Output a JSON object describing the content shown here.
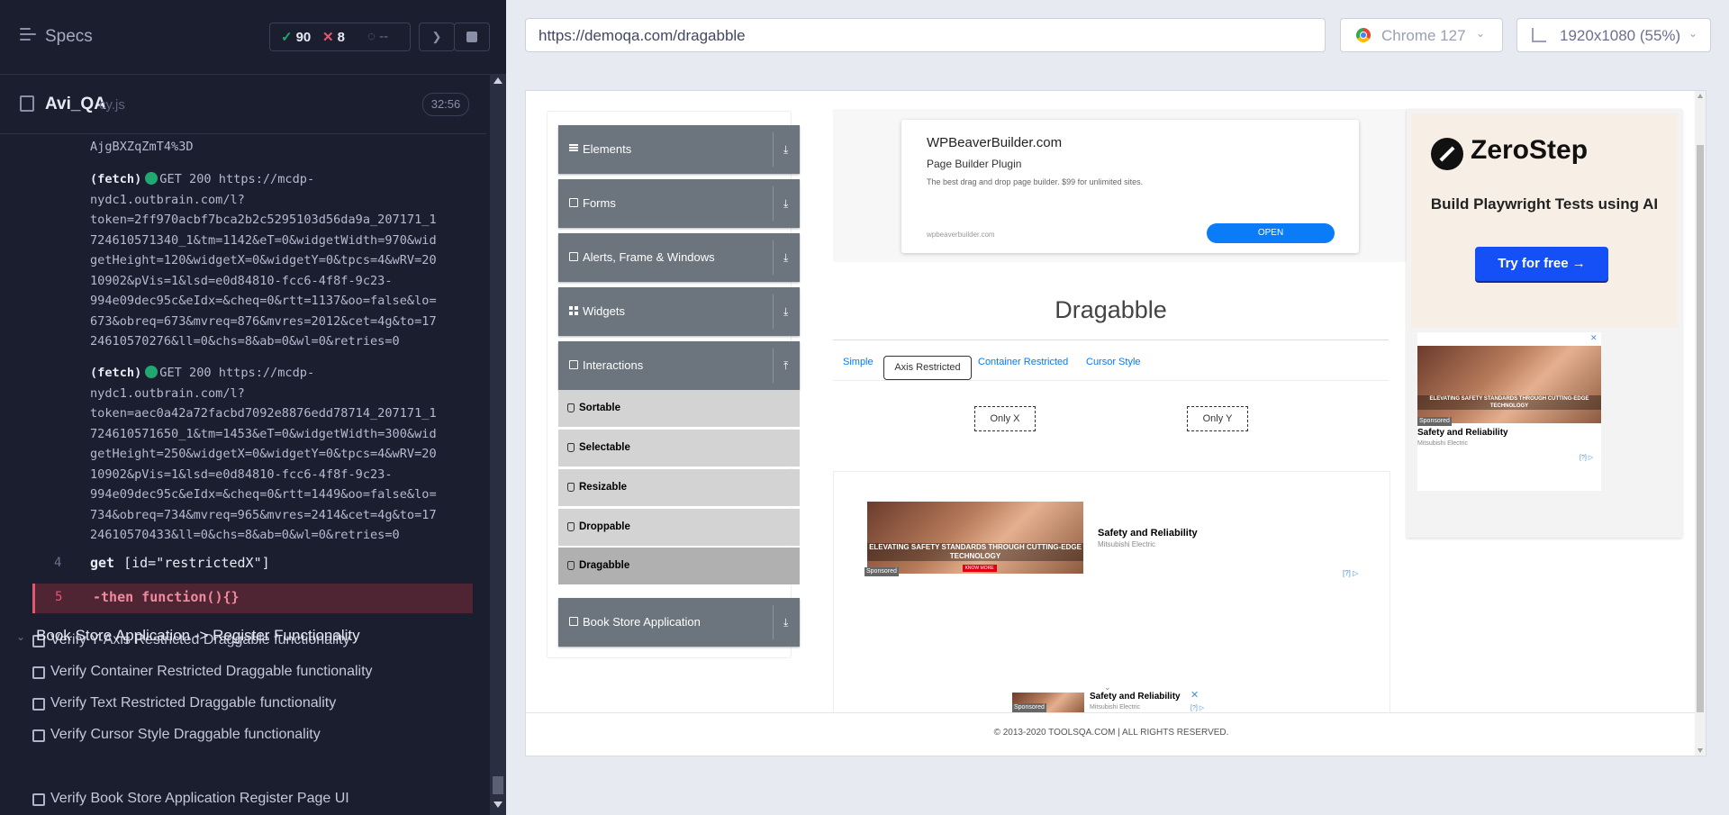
{
  "runner": {
    "specs_title": "Specs",
    "stats": {
      "passed": "90",
      "failed": "8",
      "pending": "--"
    },
    "file": {
      "name": "Avi_QA",
      "ext": "cy.js",
      "time": "32:56"
    },
    "log_top": "AjgBXZqZmT4%3D",
    "log_entry_1": "(fetch)  GET 200 https://mcdp-\nnydc1.outbrain.com/l?\ntoken=2ff970acbf7bca2b2c5295103d56da9a_207171_1\n724610571340_1&tm=1142&eT=0&widgetWidth=970&wid\ngetHeight=120&widgetX=0&widgetY=0&tpcs=4&wRV=20\n10902&pVis=1&lsd=e0d84810-fcc6-4f8f-9c23-\n994e09dec95c&eIdx=&cheq=0&rtt=1137&oo=false&lo=\n673&obreq=673&mvreq=876&mvres=2012&cet=4g&to=17\n24610570276&ll=0&chs=8&ab=0&wl=0&retries=0",
    "log_entry_2": "(fetch)  GET 200 https://mcdp-\nnydc1.outbrain.com/l?\ntoken=aec0a42a72facbd7092e8876edd78714_207171_1\n724610571650_1&tm=1453&eT=0&widgetWidth=300&wid\ngetHeight=250&widgetX=0&widgetY=0&tpcs=4&wRV=20\n10902&pVis=1&lsd=e0d84810-fcc6-4f8f-9c23-\n994e09dec95c&eIdx=&cheq=0&rtt=1449&oo=false&lo=\n734&obreq=734&mvreq=965&mvres=2414&cet=4g&to=17\n24610570433&ll=0&chs=8&ab=0&wl=0&retries=0",
    "cmd4": {
      "num": "4",
      "cmd": "get",
      "arg": "[id=\"restrictedX\"]"
    },
    "cmd5": {
      "num": "5",
      "cmd": "-then  function(){}"
    },
    "tests": [
      "Verify Y-Axis Restricted Draggable functionality",
      "Verify Container Restricted Draggable functionality",
      "Verify Text Restricted Draggable functionality",
      "Verify Cursor Style Draggable functionality"
    ],
    "suite": "Book Store Application -> Register Functionality",
    "suite_test": "Verify Book Store Application Register Page UI"
  },
  "toolbar": {
    "url": "https://demoqa.com/dragabble",
    "browser": "Chrome 127",
    "viewport": "1920x1080  (55%)"
  },
  "app": {
    "groups": {
      "elements": "Elements",
      "forms": "Forms",
      "alerts": "Alerts, Frame & Windows",
      "widgets": "Widgets",
      "interactions": "Interactions",
      "bookstore": "Book Store Application"
    },
    "interactions_items": [
      "Sortable",
      "Selectable",
      "Resizable",
      "Droppable",
      "Dragabble"
    ],
    "top_ad": {
      "heading": "WPBeaverBuilder.com",
      "subtitle": "Page Builder Plugin",
      "desc": "The best drag and drop page builder. $99 for unlimited sites.",
      "url": "wpbeaverbuilder.com",
      "button": "OPEN"
    },
    "page_title": "Dragabble",
    "tabs": {
      "simple": "Simple",
      "axis": "Axis Restricted",
      "container": "Container Restricted",
      "cursor": "Cursor Style"
    },
    "only_x": "Only X",
    "only_y": "Only Y",
    "ad_image_caption": "ELEVATING SAFETY STANDARDS THROUGH CUTTING-EDGE TECHNOLOGY",
    "ad_know_more": "KNOW MORE",
    "ad_sponsored": "Sponsored",
    "ad_title": "Safety and Reliability",
    "ad_brand": "Mitsubishi Electric",
    "ad_choices": "[?]",
    "right_ad": {
      "brand": "ZeroStep",
      "tagline": "Build Playwright Tests using AI",
      "button": "Try for free →"
    },
    "footer": "© 2013-2020 TOOLSQA.COM | ALL RIGHTS RESERVED.",
    "colors": {
      "sidebar_header": "#6c757d",
      "sub_item": "#d3d3d3",
      "link": "#007bff",
      "cta_blue": "#0a7cf7",
      "zerostep_btn": "#1450f5"
    }
  }
}
